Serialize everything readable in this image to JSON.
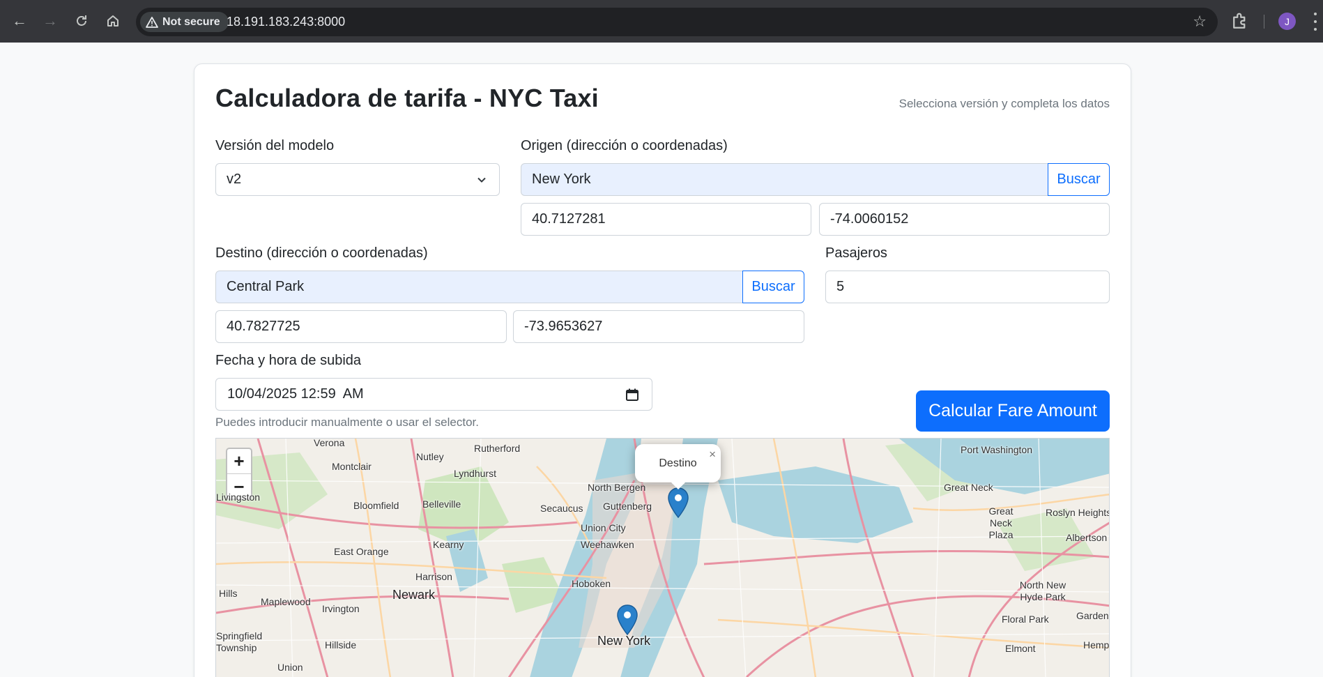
{
  "browser": {
    "security_label": "Not secure",
    "url": "18.191.183.243:8000",
    "profile_initial": "J"
  },
  "header": {
    "title": "Calculadora de tarifa - NYC Taxi",
    "subtitle": "Selecciona versión y completa los datos"
  },
  "model": {
    "label": "Versión del modelo",
    "value": "v2"
  },
  "origin": {
    "label": "Origen (dirección o coordenadas)",
    "address": "New York",
    "search_label": "Buscar",
    "lat": "40.7127281",
    "lon": "-74.0060152"
  },
  "destination": {
    "label": "Destino (dirección o coordenadas)",
    "address": "Central Park",
    "search_label": "Buscar",
    "lat": "40.7827725",
    "lon": "-73.9653627"
  },
  "passengers": {
    "label": "Pasajeros",
    "value": "5"
  },
  "pickup": {
    "label": "Fecha y hora de subida",
    "value": "10/04/2025 12:59  AM",
    "help": "Puedes introducir manualmente o usar el selector."
  },
  "submit_label": "Calcular Fare Amount",
  "map": {
    "zoom_in": "+",
    "zoom_out": "−",
    "popup_text": "Destino",
    "popup_close": "×",
    "places": [
      "Verona",
      "Rutherford",
      "Nutley",
      "Montclair",
      "Lyndhurst",
      "North Bergen",
      "Secaucus",
      "Guttenberg",
      "Bloomfield",
      "Belleville",
      "Union City",
      "Kearny",
      "Weehawken",
      "East Orange",
      "Harrison",
      "Hoboken",
      "Newark",
      "Maplewood",
      "Irvington",
      "New York",
      "Springfield Township",
      "Hillside",
      "Union",
      "Port Washington",
      "Great Neck",
      "Great Neck Plaza",
      "Roslyn Heights",
      "Albertson",
      "North New Hyde Park",
      "Floral Park",
      "Elmont",
      "Garden City",
      "Hempstead",
      "Hills",
      "Livingston"
    ]
  },
  "colors": {
    "primary": "#0d6efd",
    "autofill": "#e8f0fe",
    "marker": "#2a81cb"
  }
}
